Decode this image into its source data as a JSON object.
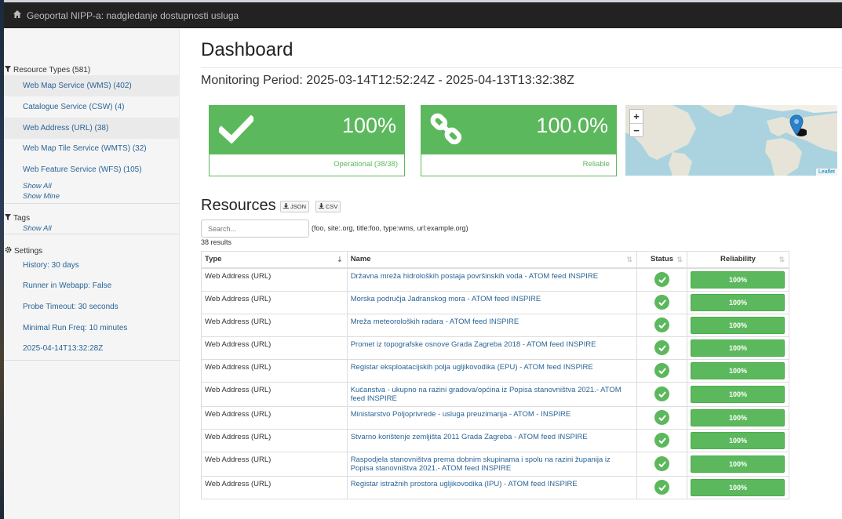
{
  "navbar": {
    "title": "Geoportal NIPP-a: nadgledanje dostupnosti usluga"
  },
  "sidebar": {
    "resource_types": {
      "heading": "Resource Types (581)",
      "items": [
        {
          "label": "Web Map Service (WMS) (402)"
        },
        {
          "label": "Catalogue Service (CSW) (4)"
        },
        {
          "label": "Web Address (URL) (38)"
        },
        {
          "label": "Web Map Tile Service (WMTS) (32)"
        },
        {
          "label": "Web Feature Service (WFS) (105)"
        }
      ],
      "show_all": "Show All",
      "show_mine": "Show Mine"
    },
    "tags": {
      "heading": "Tags",
      "show_all": "Show All"
    },
    "settings": {
      "heading": "Settings",
      "items": [
        {
          "label": "History: 30 days"
        },
        {
          "label": "Runner in Webapp: False"
        },
        {
          "label": "Probe Timeout: 30 seconds"
        },
        {
          "label": "Minimal Run Freq: 10 minutes"
        },
        {
          "label": "2025-04-14T13:32:28Z"
        }
      ]
    }
  },
  "main": {
    "title": "Dashboard",
    "monitoring_period": "Monitoring Period: 2025-03-14T12:52:24Z - 2025-04-13T13:32:38Z",
    "panels": {
      "operational": {
        "value": "100%",
        "label": "Operational (38/38)"
      },
      "reliable": {
        "value": "100.0%",
        "label": "Reliable"
      }
    },
    "map": {
      "zoom_in": "+",
      "zoom_out": "−",
      "attribution": "Leaflet"
    },
    "resources": {
      "title": "Resources",
      "json_button": "JSON",
      "csv_button": "CSV",
      "search_placeholder": "Search...",
      "search_hint": "(foo, site:.org, title:foo, type:wms, url:example.org)",
      "results_count": "38 results",
      "columns": {
        "type": "Type",
        "name": "Name",
        "status": "Status",
        "reliability": "Reliability"
      },
      "rows": [
        {
          "type": "Web Address (URL)",
          "name": "Državna mreža hidroloških postaja površinskih voda - ATOM feed INSPIRE",
          "reliability": "100%"
        },
        {
          "type": "Web Address (URL)",
          "name": "Morska područja Jadranskog mora - ATOM feed INSPIRE",
          "reliability": "100%"
        },
        {
          "type": "Web Address (URL)",
          "name": "Mreža meteoroloških radara - ATOM feed INSPIRE",
          "reliability": "100%"
        },
        {
          "type": "Web Address (URL)",
          "name": "Promet iz topografske osnove Grada Zagreba 2018 - ATOM feed INSPIRE",
          "reliability": "100%"
        },
        {
          "type": "Web Address (URL)",
          "name": "Registar eksploatacijskih polja ugljikovodika (EPU) - ATOM feed INSPIRE",
          "reliability": "100%"
        },
        {
          "type": "Web Address (URL)",
          "name": "Kućanstva - ukupno na razini gradova/općina iz Popisa stanovništva 2021.- ATOM feed INSPIRE",
          "reliability": "100%"
        },
        {
          "type": "Web Address (URL)",
          "name": "Ministarstvo Poljoprivrede - usluga preuzimanja - ATOM - INSPIRE",
          "reliability": "100%"
        },
        {
          "type": "Web Address (URL)",
          "name": "Stvarno korištenje zemljišta 2011 Grada Zagreba - ATOM feed INSPIRE",
          "reliability": "100%"
        },
        {
          "type": "Web Address (URL)",
          "name": "Raspodjela stanovništva prema dobnim skupinama i spolu na razini županija iz Popisa stanovništva 2021.- ATOM feed INSPIRE",
          "reliability": "100%"
        },
        {
          "type": "Web Address (URL)",
          "name": "Registar istražnih prostora ugljikovodika (IPU) - ATOM feed INSPIRE",
          "reliability": "100%"
        }
      ]
    }
  },
  "colors": {
    "success": "#5cb85c",
    "link": "#2a6496",
    "navbar": "#222222"
  }
}
